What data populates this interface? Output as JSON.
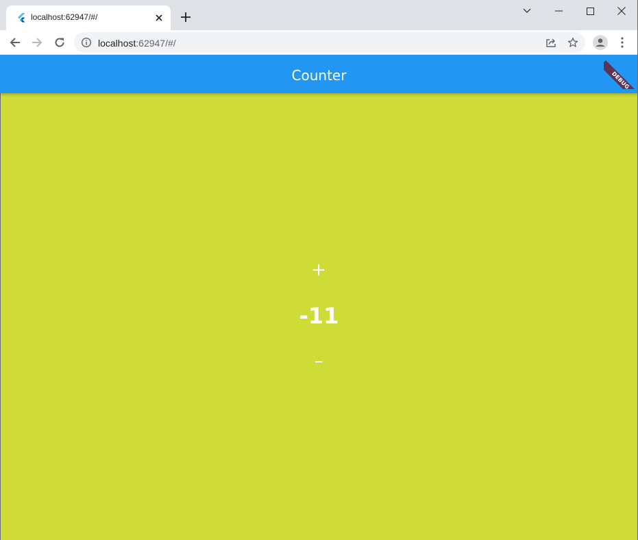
{
  "browser": {
    "tab": {
      "title": "localhost:62947/#/",
      "close_icon": "close-icon"
    },
    "new_tab_icon": "plus-icon",
    "window_controls": [
      "chevron-down-icon",
      "minimize-icon",
      "maximize-icon",
      "close-icon"
    ],
    "address": {
      "host": "localhost",
      "rest": ":62947/#/"
    }
  },
  "app": {
    "title": "Counter",
    "debug_banner": "DEBUG",
    "increment_label": "+",
    "count": "-11",
    "decrement_label": "–"
  },
  "colors": {
    "appbar": "#2196f3",
    "background": "#cfdc38",
    "text": "#ffffff"
  }
}
